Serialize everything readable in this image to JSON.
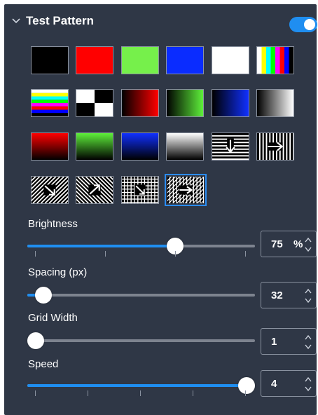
{
  "header": {
    "title": "Test Pattern",
    "toggle_on": true
  },
  "patterns": [
    {
      "name": "solid-black"
    },
    {
      "name": "solid-red"
    },
    {
      "name": "solid-green"
    },
    {
      "name": "solid-blue"
    },
    {
      "name": "solid-white"
    },
    {
      "name": "color-bars-vertical"
    },
    {
      "name": "color-bars-horizontal"
    },
    {
      "name": "checkerboard"
    },
    {
      "name": "red-gradient-horizontal"
    },
    {
      "name": "green-gradient-horizontal"
    },
    {
      "name": "blue-gradient-horizontal"
    },
    {
      "name": "gray-gradient-horizontal"
    },
    {
      "name": "red-gradient-vertical"
    },
    {
      "name": "green-gradient-vertical"
    },
    {
      "name": "blue-gradient-vertical"
    },
    {
      "name": "gray-gradient-vertical"
    },
    {
      "name": "horizontal-lines-down-arrow"
    },
    {
      "name": "vertical-lines-right-arrow"
    },
    {
      "name": "diagonal-lines-down-right-arrow"
    },
    {
      "name": "diagonal-lines-up-right-arrow"
    },
    {
      "name": "grid-lines-arrow"
    },
    {
      "name": "diagonal-grid-right-arrow",
      "selected": true
    }
  ],
  "sliders": [
    {
      "label": "Brightness",
      "value": "75",
      "unit": "%",
      "fraction": 0.65,
      "ticks": true
    },
    {
      "label": "Spacing (px)",
      "value": "32",
      "unit": "",
      "fraction": 0.07,
      "ticks": false
    },
    {
      "label": "Grid Width",
      "value": "1",
      "unit": "",
      "fraction": 0.0,
      "ticks": false
    },
    {
      "label": "Speed",
      "value": "4",
      "unit": "",
      "fraction": 1.0,
      "ticks": true
    }
  ],
  "colors": {
    "accent": "#1f8ef1",
    "panel": "#2f3746",
    "track": "#7d838f"
  }
}
